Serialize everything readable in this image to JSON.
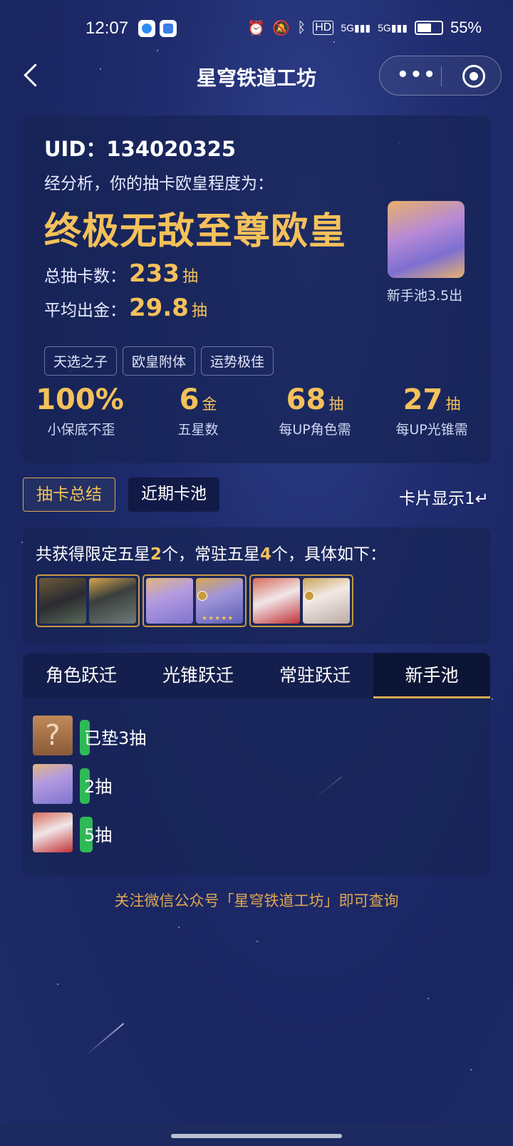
{
  "status_bar": {
    "time": "12:07",
    "battery": "55%",
    "network_1": "HD",
    "network_2": "5G",
    "network_3": "5G",
    "icons": [
      "alarm-icon",
      "mute-bell-icon",
      "bluetooth-icon",
      "signal-icon",
      "battery-icon"
    ]
  },
  "nav": {
    "title": "星穹铁道工坊",
    "more_label": "•••"
  },
  "summary": {
    "uid": "UID：134020325",
    "analysis": "经分析，你的抽卡欧皇程度为：",
    "rank": "终极无敌至尊欧皇",
    "total_label": "总抽卡数：",
    "total_value": "233",
    "total_unit": "抽",
    "avg_label": "平均出金：",
    "avg_value": "29.8",
    "avg_unit": "抽",
    "featured_caption": "新手池3.5出",
    "tags": [
      "天选之子",
      "欧皇附体",
      "运势极佳"
    ],
    "metrics": [
      {
        "value": "100%",
        "unit": "",
        "label": "小保底不歪"
      },
      {
        "value": "6",
        "unit": "金",
        "label": "五星数"
      },
      {
        "value": "68",
        "unit": "抽",
        "label": "每UP角色需"
      },
      {
        "value": "27",
        "unit": "抽",
        "label": "每UP光锥需"
      }
    ]
  },
  "view_tabs": {
    "active": "抽卡总结",
    "inactive": "近期卡池",
    "card_toggle": "卡片显示1↵"
  },
  "obtained": {
    "prefix": "共获得限定五星",
    "limited_count": "2",
    "middle": "个，常驻五星",
    "standard_count": "4",
    "suffix": "个，具体如下："
  },
  "pool_tabs": [
    "角色跃迁",
    "光锥跃迁",
    "常驻跃迁",
    "新手池"
  ],
  "pool_active_index": 3,
  "pulls": [
    {
      "text": "已垫3抽",
      "avatar": "?",
      "progress": 0.04
    },
    {
      "text": "2抽",
      "avatar": "",
      "progress": 0.03
    },
    {
      "text": "5抽",
      "avatar": "",
      "progress": 0.06
    }
  ],
  "footer_note": "关注微信公众号「星穹铁道工坊」即可查询",
  "colors": {
    "gold": "#f4c15a",
    "progress_green": "#2fb957",
    "background": "#1f2c6e"
  }
}
